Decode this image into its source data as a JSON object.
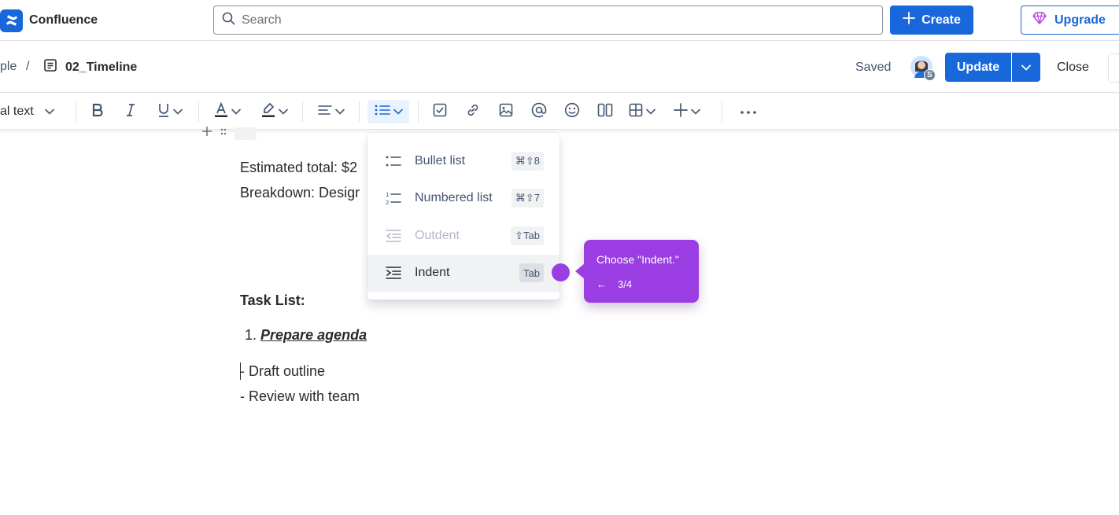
{
  "app": {
    "name": "Confluence"
  },
  "search": {
    "placeholder": "Search"
  },
  "topbar": {
    "create_label": "Create",
    "upgrade_label": "Upgrade"
  },
  "breadcrumb": {
    "parent": "ple",
    "separator": "/",
    "page_title": "02_Timeline"
  },
  "status": {
    "saved": "Saved"
  },
  "avatar": {
    "badge": "S"
  },
  "actions": {
    "update_label": "Update",
    "close_label": "Close"
  },
  "toolbar": {
    "text_style": "al text",
    "items": [
      "bold-icon",
      "italic-icon",
      "underline-icon",
      "text-color-icon",
      "highlight-icon",
      "align-icon",
      "list-icon",
      "task-icon",
      "link-icon",
      "image-icon",
      "mention-icon",
      "emoji-icon",
      "layout-icon",
      "table-icon",
      "insert-icon",
      "more-icon"
    ]
  },
  "content": {
    "line1": "Estimated total: $2",
    "line2": "Breakdown: Desigr",
    "task_heading": "Task List:",
    "task_number": "1.",
    "task_item": "Prepare agenda",
    "draft": "- Draft outline",
    "review": "- Review with team"
  },
  "list_menu": {
    "items": [
      {
        "label": "Bullet list",
        "shortcut": "⌘⇧8",
        "state": "enabled"
      },
      {
        "label": "Numbered list",
        "shortcut": "⌘⇧7",
        "state": "enabled"
      },
      {
        "label": "Outdent",
        "shortcut": "⇧Tab",
        "state": "disabled"
      },
      {
        "label": "Indent",
        "shortcut": "Tab",
        "state": "selected"
      }
    ]
  },
  "guide": {
    "text": "Choose \"Indent.\"",
    "back_arrow": "←",
    "progress": "3/4",
    "color": "#9a3de3"
  },
  "colors": {
    "primary": "#1868db",
    "guide": "#9a3de3"
  }
}
